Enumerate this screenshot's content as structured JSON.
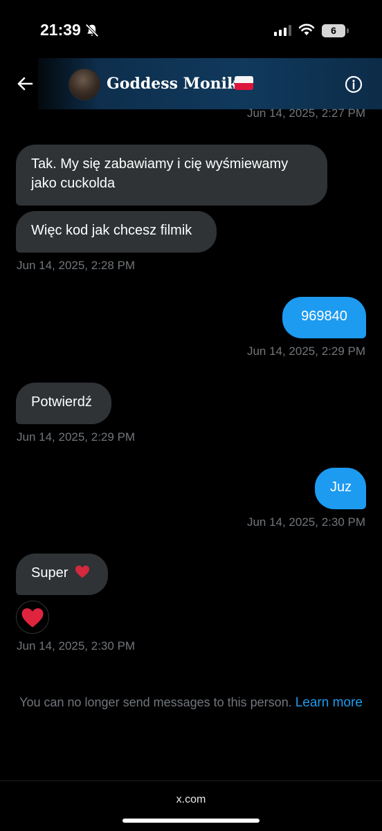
{
  "status": {
    "time": "21:39",
    "battery": "6"
  },
  "header": {
    "contact_name": "Goddess Monika",
    "flag": "Poland",
    "icons": [
      "back-arrow-icon",
      "avatar",
      "info-icon"
    ]
  },
  "messages": [
    {
      "ts": "Jun 14, 2025, 2:27 PM"
    },
    {
      "direction": "in",
      "text": "Tak. My się zabawiamy i cię wyśmiewamy jako cuckolda"
    },
    {
      "direction": "in",
      "text": "Więc kod jak chcesz filmik"
    },
    {
      "ts": "Jun 14, 2025, 2:28 PM"
    },
    {
      "direction": "out",
      "text": "969840"
    },
    {
      "ts": "Jun 14, 2025, 2:29 PM"
    },
    {
      "direction": "in",
      "text": "Potwierdź"
    },
    {
      "ts": "Jun 14, 2025, 2:29 PM"
    },
    {
      "direction": "out",
      "text": "Juz"
    },
    {
      "ts": "Jun 14, 2025, 2:30 PM"
    },
    {
      "direction": "in",
      "text": "Super",
      "emoji": "heart"
    },
    {
      "reaction": "heart"
    },
    {
      "ts": "Jun 14, 2025, 2:30 PM"
    }
  ],
  "notice": {
    "text": "You can no longer send messages to this person.",
    "link": "Learn more"
  },
  "browser": {
    "domain": "x.com"
  },
  "colors": {
    "incoming_bubble": "#2f3336",
    "outgoing_bubble": "#1d9bf0",
    "timestamp": "#71767b",
    "link": "#1d9bf0"
  }
}
